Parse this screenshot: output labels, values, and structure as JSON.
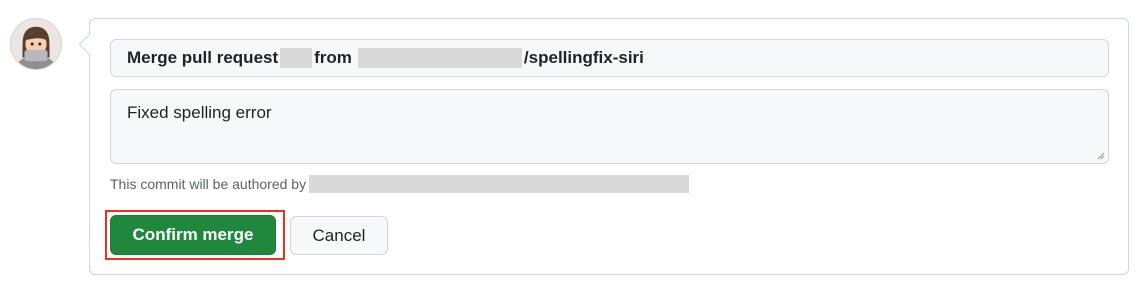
{
  "merge_form": {
    "title_prefix": "Merge pull request",
    "title_from": "from",
    "title_branch": "/spellingfix-siri",
    "description": "Fixed spelling error",
    "author_note": "This commit will be authored by",
    "confirm_label": "Confirm merge",
    "cancel_label": "Cancel"
  },
  "colors": {
    "confirm_bg": "#1f883d",
    "highlight": "#e8341c"
  },
  "icons": {
    "avatar": "user-avatar-icon",
    "resize": "resize-handle-icon"
  }
}
